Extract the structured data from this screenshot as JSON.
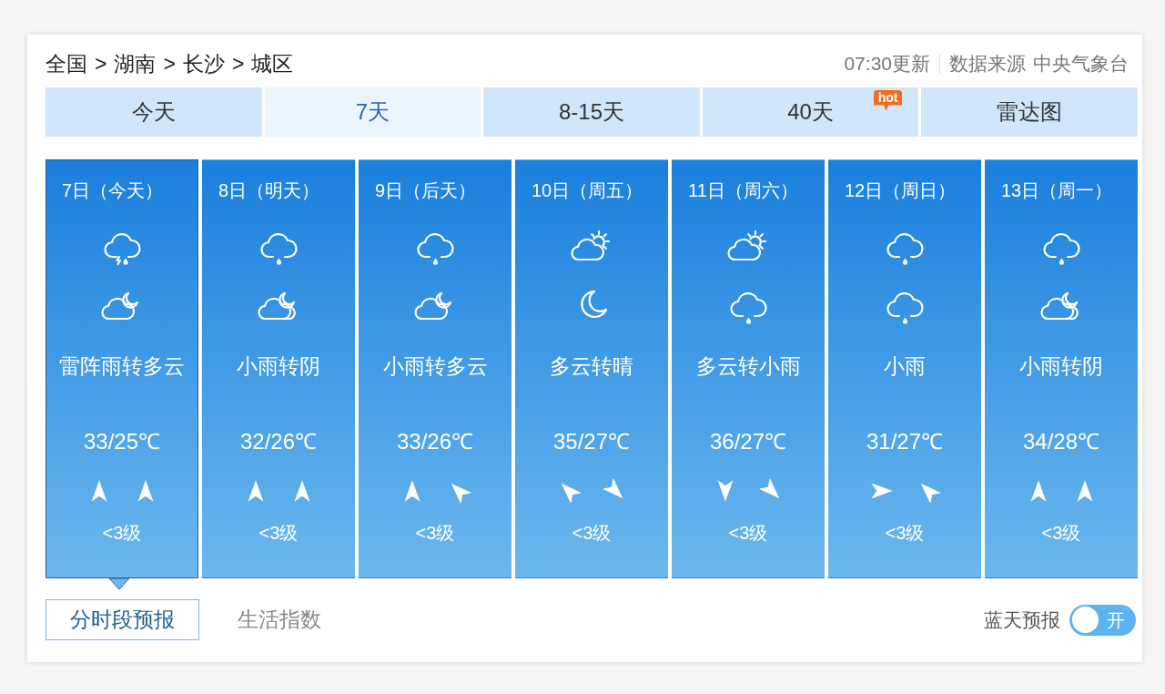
{
  "breadcrumb": [
    {
      "label": "全国"
    },
    {
      "separator": ">",
      "label": "湖南"
    },
    {
      "separator": ">",
      "label": "长沙"
    },
    {
      "separator": ">",
      "label": "城区"
    }
  ],
  "update": {
    "time": "07:30更新",
    "source_label": "数据来源",
    "source": "中央气象台"
  },
  "tabs": [
    {
      "label": "今天",
      "selected": false
    },
    {
      "label": "7天",
      "selected": true
    },
    {
      "label": "8-15天",
      "selected": false
    },
    {
      "label": "40天",
      "selected": false,
      "badge": "hot"
    },
    {
      "label": "雷达图",
      "selected": false
    }
  ],
  "days": [
    {
      "date": "7日（今天）",
      "selected": true,
      "weather_icons": [
        {
          "kind": "thunderstorm"
        },
        {
          "kind": "mooncloud"
        }
      ],
      "weather": "雷阵雨转多云",
      "temperature": "33/25℃",
      "wind_arrows": [
        {
          "kind": "up"
        },
        {
          "kind": "up"
        }
      ],
      "wind_level": "<3级"
    },
    {
      "date": "8日（明天）",
      "selected": false,
      "weather_icons": [
        {
          "kind": "rain"
        },
        {
          "kind": "moonclouds"
        }
      ],
      "weather": "小雨转阴",
      "temperature": "32/26℃",
      "wind_arrows": [
        {
          "kind": "up"
        },
        {
          "kind": "up"
        }
      ],
      "wind_level": "<3级"
    },
    {
      "date": "9日（后天）",
      "selected": false,
      "weather_icons": [
        {
          "kind": "rain"
        },
        {
          "kind": "mooncloud"
        }
      ],
      "weather": "小雨转多云",
      "temperature": "33/26℃",
      "wind_arrows": [
        {
          "kind": "up"
        },
        {
          "kind": "upleft"
        }
      ],
      "wind_level": "<3级"
    },
    {
      "date": "10日（周五）",
      "selected": false,
      "weather_icons": [
        {
          "kind": "suncloud"
        },
        {
          "kind": "moon"
        }
      ],
      "weather": "多云转晴",
      "temperature": "35/27℃",
      "wind_arrows": [
        {
          "kind": "upleft"
        },
        {
          "kind": "downright"
        }
      ],
      "wind_level": "<3级"
    },
    {
      "date": "11日（周六）",
      "selected": false,
      "weather_icons": [
        {
          "kind": "suncloud"
        },
        {
          "kind": "rain"
        }
      ],
      "weather": "多云转小雨",
      "temperature": "36/27℃",
      "wind_arrows": [
        {
          "kind": "down"
        },
        {
          "kind": "downright"
        }
      ],
      "wind_level": "<3级"
    },
    {
      "date": "12日（周日）",
      "selected": false,
      "weather_icons": [
        {
          "kind": "rain"
        },
        {
          "kind": "rain"
        }
      ],
      "weather": "小雨",
      "temperature": "31/27℃",
      "wind_arrows": [
        {
          "kind": "right"
        },
        {
          "kind": "upleft"
        }
      ],
      "wind_level": "<3级"
    },
    {
      "date": "13日（周一）",
      "selected": false,
      "weather_icons": [
        {
          "kind": "rain"
        },
        {
          "kind": "moonclouds"
        }
      ],
      "weather": "小雨转阴",
      "temperature": "34/28℃",
      "wind_arrows": [
        {
          "kind": "up"
        },
        {
          "kind": "up"
        }
      ],
      "wind_level": "<3级"
    }
  ],
  "sub_tabs": [
    {
      "label": "分时段预报",
      "selected": true
    },
    {
      "label": "生活指数",
      "selected": false
    }
  ],
  "switch": {
    "label": "蓝天预报",
    "on": false,
    "text": "开"
  }
}
